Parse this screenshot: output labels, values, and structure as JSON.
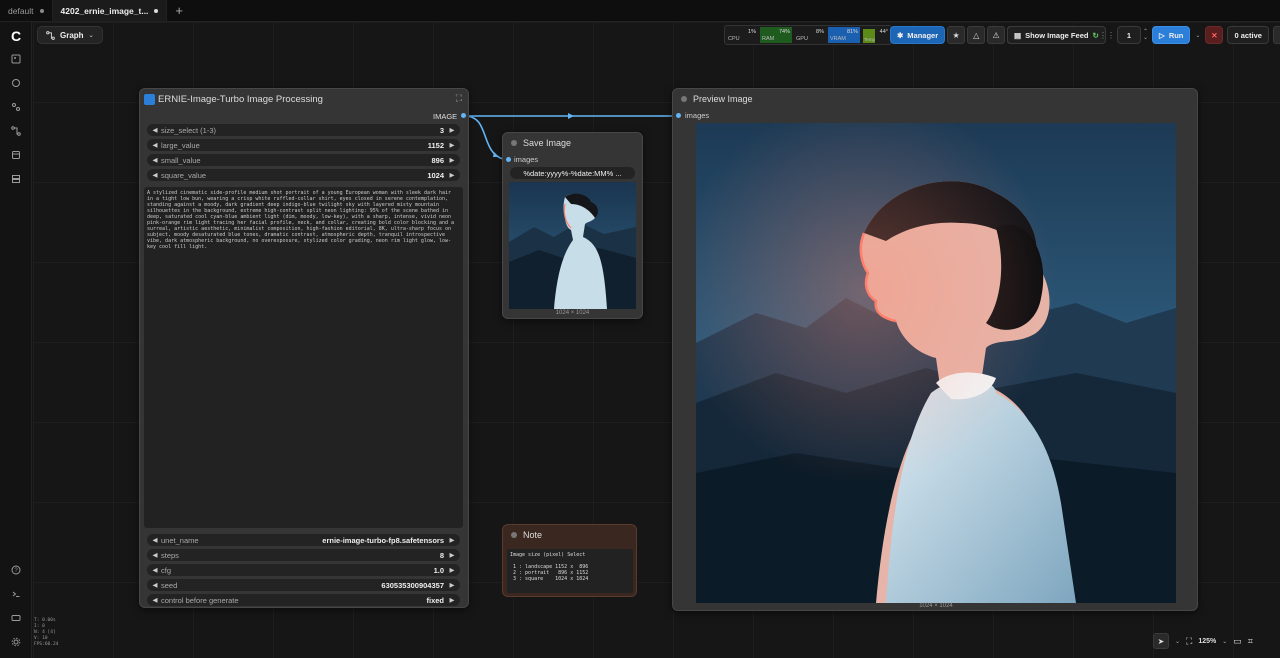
{
  "tabs": [
    {
      "label": "default",
      "active": false
    },
    {
      "label": "4202_ernie_image_t...",
      "active": true
    }
  ],
  "graph_button": "Graph",
  "stats": [
    {
      "label": "CPU",
      "value": "1%"
    },
    {
      "label": "RAM",
      "value": "74%"
    },
    {
      "label": "GPU",
      "value": "8%"
    },
    {
      "label": "VRAM",
      "value": "81%"
    },
    {
      "label": "Temp",
      "value": "44°"
    }
  ],
  "toolbar": {
    "manager": "Manager",
    "show_feed": "Show Image Feed",
    "queue_count": "1",
    "run": "Run",
    "active": "0 active"
  },
  "ernie_node": {
    "title": "ERNIE-Image-Turbo Image Processing",
    "output_label": "IMAGE",
    "widgets": [
      {
        "label": "size_select (1-3)",
        "value": "3"
      },
      {
        "label": "large_value",
        "value": "1152"
      },
      {
        "label": "small_value",
        "value": "896"
      },
      {
        "label": "square_value",
        "value": "1024"
      }
    ],
    "prompt": "A stylized cinematic side-profile medium shot portrait of a young European woman with sleek dark hair in a tight low bun, wearing a crisp white ruffled-collar shirt, eyes closed in serene contemplation, standing against a moody, dark gradient deep indigo-blue twilight sky with layered misty mountain silhouettes in the background, extreme high-contrast split neon lighting: 95% of the scene bathed in deep, saturated cool cyan-blue ambient light (dim, moody, low-key), with a sharp, intense, vivid neon pink-orange rim light tracing her facial profile, neck, and collar, creating bold color blocking and a surreal, artistic aesthetic, minimalist composition, high-fashion editorial, 8K, ultra-sharp focus on subject, moody desaturated blue tones, dramatic contrast, atmospheric depth, tranquil introspective vibe, dark atmospheric background, no overexposure, stylized color grading, neon rim light glow, low-key cool fill light.",
    "lower_widgets": [
      {
        "label": "unet_name",
        "value": "ernie-image-turbo-fp8.safetensors"
      },
      {
        "label": "steps",
        "value": "8"
      },
      {
        "label": "cfg",
        "value": "1.0"
      },
      {
        "label": "seed",
        "value": "630535300904357"
      },
      {
        "label": "control before generate",
        "value": "fixed"
      }
    ]
  },
  "save_node": {
    "title": "Save Image",
    "input_label": "images",
    "filename_prefix": "%date:yyyy%-%date:MM% ...",
    "caption": "1024 × 1024"
  },
  "note_node": {
    "title": "Note",
    "text": "Image size (pixel) Select\n\n 1 : landscape 1152 x  896\n 2 : portrait   896 x 1152\n 3 : square    1024 x 1024"
  },
  "preview_node": {
    "title": "Preview Image",
    "input_label": "images",
    "caption": "1024 × 1024"
  },
  "bottom_info": [
    "T: 0.00s",
    "I: 0",
    "N: 4 [4]",
    "V: 10",
    "FPS:60.24"
  ],
  "zoom": "125%",
  "colors": {
    "link": "#64b5f6",
    "accent": "#2b7fd9"
  }
}
